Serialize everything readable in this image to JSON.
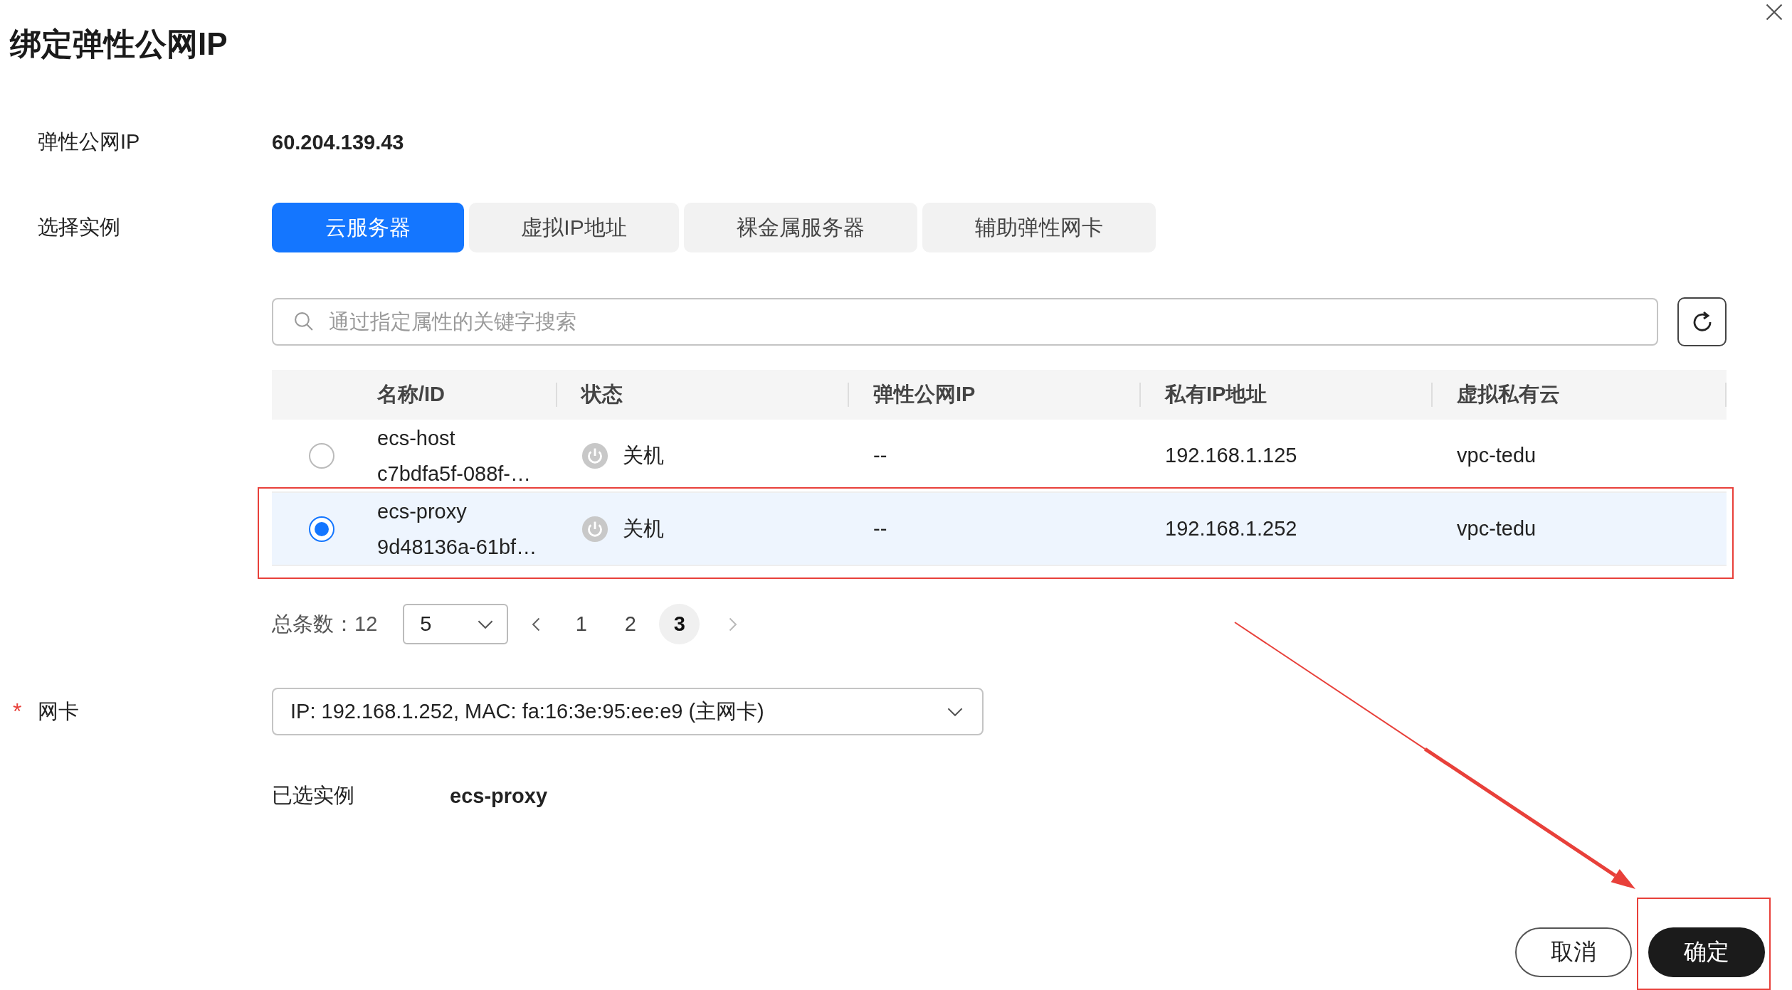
{
  "dialog": {
    "title": "绑定弹性公网IP"
  },
  "eip": {
    "label": "弹性公网IP",
    "value": "60.204.139.43"
  },
  "instance_type": {
    "label": "选择实例",
    "tabs": [
      {
        "label": "云服务器",
        "selected": true
      },
      {
        "label": "虚拟IP地址",
        "selected": false
      },
      {
        "label": "裸金属服务器",
        "selected": false
      },
      {
        "label": "辅助弹性网卡",
        "selected": false
      }
    ]
  },
  "search": {
    "placeholder": "通过指定属性的关键字搜索"
  },
  "table": {
    "columns": [
      "名称/ID",
      "状态",
      "弹性公网IP",
      "私有IP地址",
      "虚拟私有云"
    ],
    "rows": [
      {
        "selected": false,
        "highlighted": false,
        "name": "ecs-host",
        "id": "c7bdfa5f-088f-…",
        "status": "关机",
        "eip": "--",
        "private_ip": "192.168.1.125",
        "vpc": "vpc-tedu"
      },
      {
        "selected": true,
        "highlighted": true,
        "name": "ecs-proxy",
        "id": "9d48136a-61bf…",
        "status": "关机",
        "eip": "--",
        "private_ip": "192.168.1.252",
        "vpc": "vpc-tedu"
      }
    ]
  },
  "pagination": {
    "total": "总条数：12",
    "page_size": "5",
    "pages": [
      {
        "label": "1",
        "selected": false
      },
      {
        "label": "2",
        "selected": false
      },
      {
        "label": "3",
        "selected": true
      }
    ]
  },
  "nic": {
    "label": "网卡",
    "required_mark": "*",
    "value": "IP: 192.168.1.252, MAC: fa:16:3e:95:ee:e9 (主网卡)"
  },
  "selected_instance": {
    "label": "已选实例",
    "value": "ecs-proxy"
  },
  "buttons": [
    {
      "label": "取消",
      "kind": "secondary",
      "highlighted": false
    },
    {
      "label": "确定",
      "kind": "primary",
      "highlighted": true
    }
  ]
}
